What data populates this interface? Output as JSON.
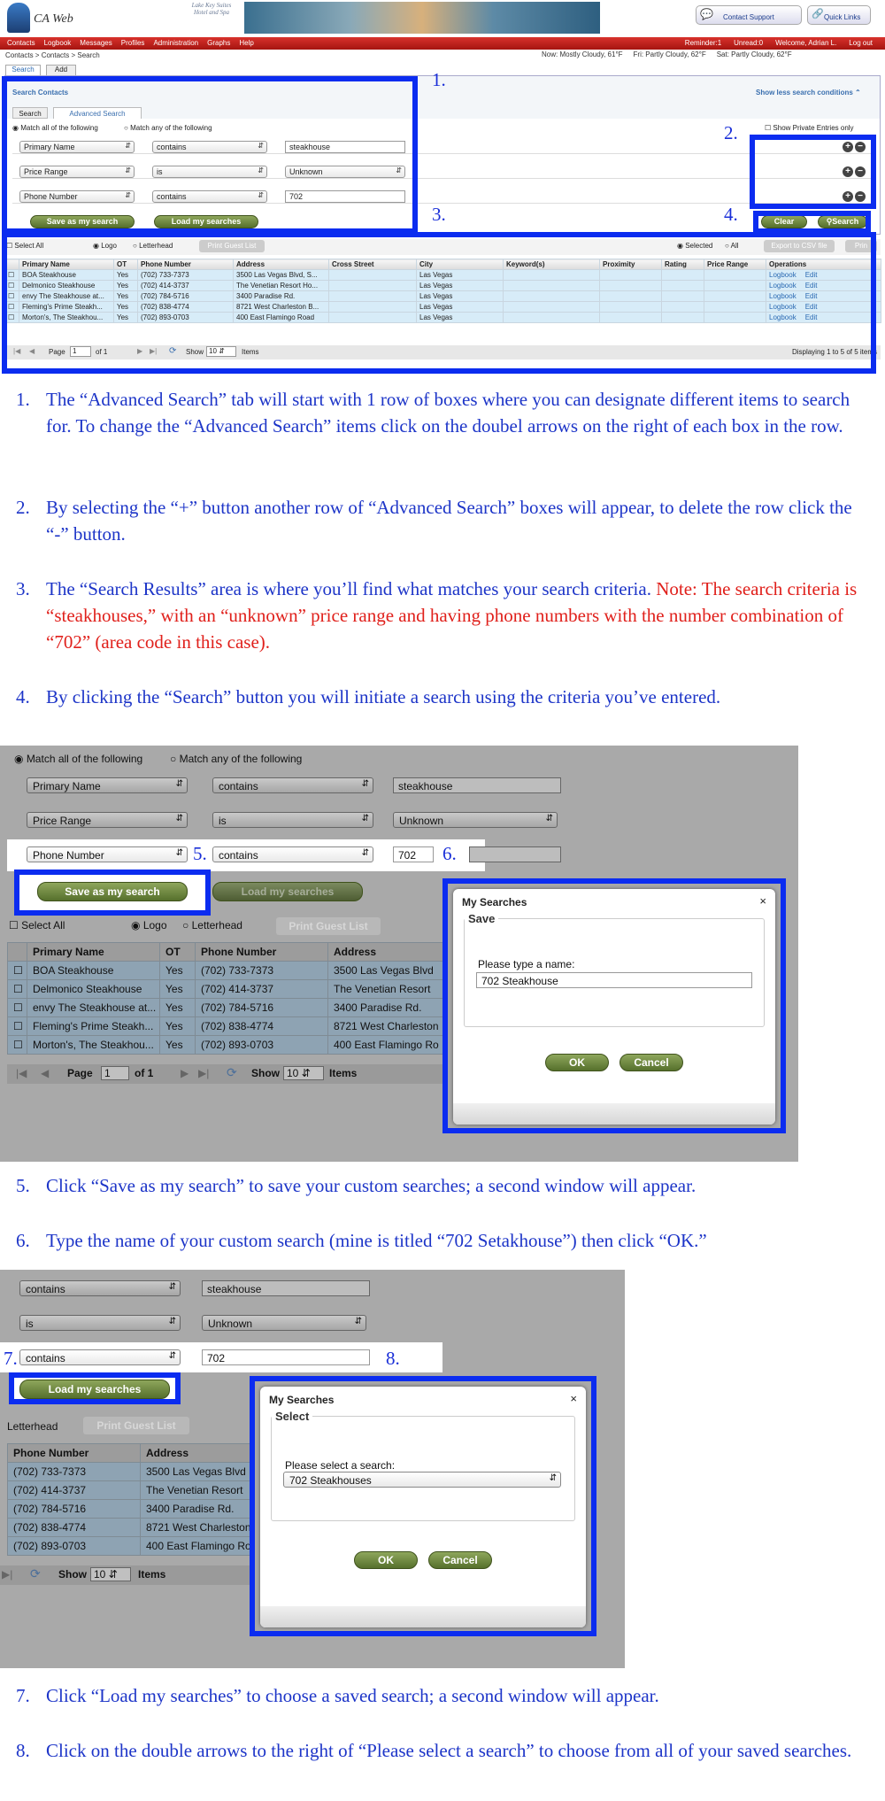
{
  "app": {
    "name": "CA Web",
    "hotel_logo": "Lake Key Suites Hotel and Spa",
    "support": "Contact Support",
    "quick_links": "Quick Links"
  },
  "nav": {
    "items": [
      "Contacts",
      "Logbook",
      "Messages",
      "Profiles",
      "Administration",
      "Graphs",
      "Help"
    ],
    "reminder": "Reminder:1",
    "unread": "Unread:0",
    "welcome": "Welcome, Adrian L.",
    "logout": "Log out"
  },
  "breadcrumb": "Contacts > Contacts > Search",
  "weather": {
    "now": "Now: Mostly Cloudy, 61°F",
    "fri": "Fri: Partly Cloudy, 62°F",
    "sat": "Sat: Partly Cloudy, 62°F"
  },
  "tabs": {
    "search": "Search",
    "add": "Add"
  },
  "panel": {
    "title": "Search Contacts",
    "show_less": "Show less search conditions",
    "subtab_search": "Search",
    "subtab_adv": "Advanced Search",
    "match_all": "Match all of the following",
    "match_any": "Match any of the following",
    "show_private": "Show Private Entries only",
    "save_btn": "Save as my search",
    "load_btn": "Load my searches",
    "clear_btn": "Clear",
    "search_btn": "Search"
  },
  "criteria": [
    {
      "field": "Primary Name",
      "op": "contains",
      "value": "steakhouse",
      "value_type": "input"
    },
    {
      "field": "Price Range",
      "op": "is",
      "value": "Unknown",
      "value_type": "select"
    },
    {
      "field": "Phone Number",
      "op": "contains",
      "value": "702",
      "value_type": "input"
    }
  ],
  "results_bar": {
    "select_all": "Select All",
    "logo": "Logo",
    "letterhead": "Letterhead",
    "print": "Print Guest List",
    "selected": "Selected",
    "all": "All",
    "export": "Export to CSV file",
    "print2": "Prin"
  },
  "columns": [
    "Primary Name",
    "OT",
    "Phone Number",
    "Address",
    "Cross Street",
    "City",
    "Keyword(s)",
    "Proximity",
    "Rating",
    "Price Range",
    "Operations"
  ],
  "rows": [
    {
      "name": "BOA Steakhouse",
      "ot": "Yes",
      "phone": "(702) 733-7373",
      "address": "3500 Las Vegas Blvd, S...",
      "address_full": "3500 Las Vegas Blvd",
      "city": "Las Vegas"
    },
    {
      "name": "Delmonico Steakhouse",
      "ot": "Yes",
      "phone": "(702) 414-3737",
      "address": "The Venetian Resort Ho...",
      "address_full": "The Venetian Resort",
      "city": "Las Vegas"
    },
    {
      "name": "envy The Steakhouse at...",
      "ot": "Yes",
      "phone": "(702) 784-5716",
      "address": "3400 Paradise Rd.",
      "address_full": "3400 Paradise Rd.",
      "city": "Las Vegas"
    },
    {
      "name": "Fleming's Prime Steakh...",
      "ot": "Yes",
      "phone": "(702) 838-4774",
      "address": "8721 West Charleston B...",
      "address_full": "8721 West Charleston",
      "city": "Las Vegas"
    },
    {
      "name": "Morton's, The Steakhou...",
      "ot": "Yes",
      "phone": "(702) 893-0703",
      "address": "400 East Flamingo Road",
      "address_full": "400 East Flamingo Ro",
      "city": "Las Vegas"
    }
  ],
  "ops": {
    "logbook": "Logbook",
    "edit": "Edit"
  },
  "pager": {
    "page": "Page",
    "page_num": "1",
    "of": "of 1",
    "show": "Show",
    "show_num": "10",
    "items": "Items",
    "displaying": "Displaying 1 to 5 of 5 items"
  },
  "markers": {
    "m1": "1.",
    "m2": "2.",
    "m3": "3.",
    "m4": "4.",
    "m5": "5.",
    "m6": "6.",
    "m7": "7.",
    "m8": "8."
  },
  "doc": {
    "p1_n": "1.",
    "p1": "The “Advanced Search” tab will start with 1 row of boxes where you can designate different items to search for.  To change the “Advanced Search” items click on the doubel arrows on the right of each box in the row.",
    "p2_n": "2.",
    "p2": "By selecting the “+” button another row of “Advanced Search” boxes will appear, to delete the row click the “-” button.",
    "p3_n": "3.",
    "p3": "The “Search Results” area is where you’ll find what matches your search criteria.  ",
    "p3_red": "Note: The search criteria is “steakhouses,” with an “unknown” price range and having phone numbers with the number combination of “702” (area code in this case).",
    "p4_n": "4.",
    "p4": "By clicking the “Search” button you will initiate a search using the criteria you’ve entered.",
    "p5_n": "5.",
    "p5": "Click “Save as my search” to save your custom searches; a second window will appear.",
    "p6_n": "6.",
    "p6": "Type the name of your custom search (mine is titled “702 Setakhouse”) then click “OK.”",
    "p7_n": "7.",
    "p7": "Click “Load my searches” to choose a saved search; a second window will appear.",
    "p8_n": "8.",
    "p8": "Click on the double arrows to the right of “Please select a search” to choose from all of your saved searches."
  },
  "dialog_save": {
    "title": "My Searches",
    "legend": "Save",
    "label": "Please type a name:",
    "value": "702 Steakhouse",
    "ok": "OK",
    "cancel": "Cancel"
  },
  "dialog_load": {
    "title": "My Searches",
    "legend": "Select",
    "label": "Please select a search:",
    "value": "702 Steakhouses",
    "ok": "OK",
    "cancel": "Cancel"
  }
}
